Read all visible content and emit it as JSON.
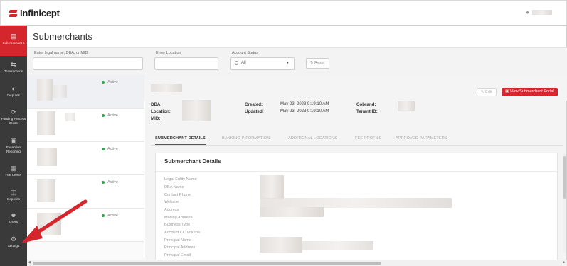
{
  "app": {
    "brand": "Infinicept"
  },
  "sidebar": {
    "items": [
      {
        "label": "Submerchant s",
        "icon": "storefront-icon",
        "active": true
      },
      {
        "label": "Transactions",
        "icon": "arrows-exchange-icon"
      },
      {
        "label": "Disputes",
        "icon": "dispute-icon"
      },
      {
        "label": "Funding Process Center",
        "icon": "refresh-cycle-icon"
      },
      {
        "label": "Exception Reporting",
        "icon": "report-icon"
      },
      {
        "label": "Fee Center",
        "icon": "fee-icon"
      },
      {
        "label": "Deposits",
        "icon": "deposit-icon"
      },
      {
        "label": "Users",
        "icon": "users-icon"
      },
      {
        "label": "Settings",
        "icon": "gear-icon"
      }
    ]
  },
  "page": {
    "title": "Submerchants"
  },
  "filters": {
    "search_label": "Enter legal name, DBA, or MID",
    "location_label": "Enter Location",
    "status_label": "Account Status",
    "status_value": "All",
    "reset_label": "Reset"
  },
  "list": {
    "items": [
      {
        "status": "Active"
      },
      {
        "status": "Active"
      },
      {
        "status": "Active"
      },
      {
        "status": "Active"
      },
      {
        "status": "Active"
      }
    ]
  },
  "detail": {
    "edit_label": "Edit",
    "portal_label": "View Submerchant Portal",
    "dba_label": "DBA:",
    "location_label": "Location:",
    "mid_label": "MID:",
    "created_label": "Created:",
    "created_value": "May 23, 2023 9:19:10 AM",
    "updated_label": "Updated:",
    "updated_value": "May 23, 2023 9:19:10 AM",
    "cobrand_label": "Cobrand:",
    "tenant_label": "Tenant ID:",
    "tabs": [
      "SUBMERCHANT DETAILS",
      "BANKING INFORMATION",
      "ADDITIONAL LOCATIONS",
      "FEE PROFILE",
      "APPROVED PARAMETERS"
    ],
    "section_title": "Submerchant Details",
    "fields": [
      "Legal Entity Name",
      "DBA Name",
      "Contact Phone",
      "Website",
      "Address",
      "Mailing Address",
      "Business Type",
      "Account CC Volume",
      "Principal Name",
      "Principal Address",
      "Principal Email"
    ]
  },
  "colors": {
    "accent": "#d6262d",
    "sidebar": "#3a3a3a",
    "active_dot": "#2ca84b",
    "annotation_arrow": "#d6262d"
  }
}
